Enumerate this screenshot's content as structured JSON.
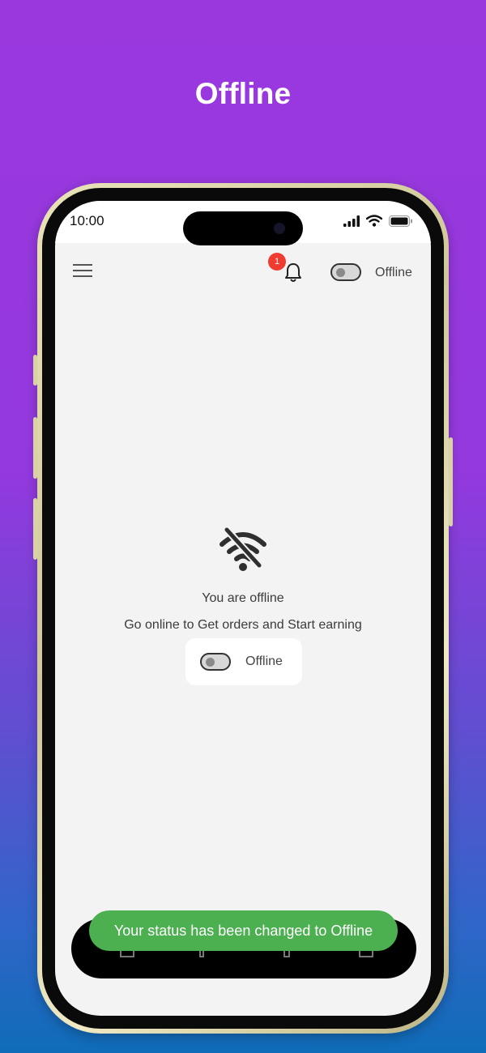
{
  "promo": {
    "title": "Offline"
  },
  "status_bar": {
    "time": "10:00"
  },
  "header": {
    "notification_count": "1",
    "status_label": "Offline"
  },
  "offline": {
    "title": "You are offline",
    "subtitle": "Go online to Get orders and Start earning",
    "toggle_label": "Offline"
  },
  "toast": {
    "message": "Your status has been changed to Offline"
  },
  "colors": {
    "accent_purple": "#9a38de",
    "toast_green": "#4caf50",
    "badge_red": "#ef3b30",
    "screen_bg": "#f3f3f3"
  },
  "icons": {
    "menu": "hamburger-menu-icon",
    "bell": "bell-icon",
    "wifi_off": "wifi-off-icon",
    "signal": "cellular-signal-icon",
    "wifi": "wifi-icon",
    "battery": "battery-icon"
  }
}
